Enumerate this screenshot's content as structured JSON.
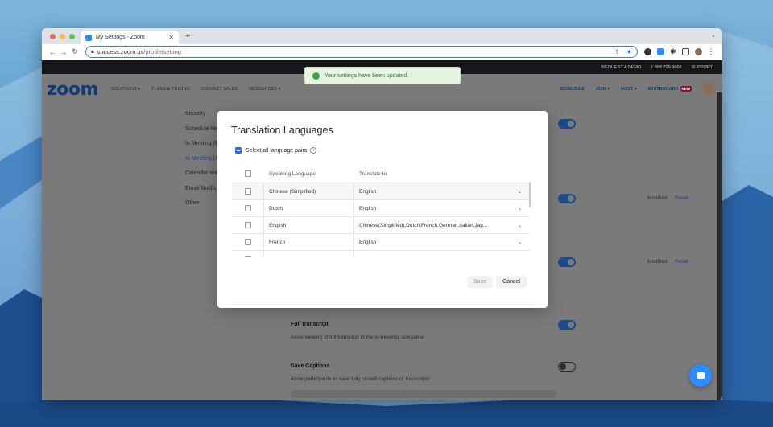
{
  "browser": {
    "tab_title": "My Settings - Zoom",
    "new_tab": "+",
    "url_host": "success.zoom.us",
    "url_path": "/profile/setting"
  },
  "zoom": {
    "topstrip": [
      "REQUEST A DEMO",
      "1.888.799.9666",
      "SUPPORT"
    ],
    "logo": "zoom",
    "nav_left": [
      "SOLUTIONS ▾",
      "PLANS & PRICING",
      "CONTACT SALES",
      "RESOURCES ▾"
    ],
    "nav_right": {
      "schedule": "SCHEDULE",
      "join": "JOIN ▾",
      "host": "HOST ▾",
      "whiteboard": "WHITEBOARD",
      "new_badge": "NEW"
    },
    "sidenav": [
      "Security",
      "Schedule Me",
      "In Meeting (B",
      "In Meeting (A",
      "Calendar and",
      "Email Notific",
      "Other"
    ],
    "modified_label": "Modified",
    "reset_label": "Reset",
    "settings": [
      {
        "title": "Full transcript",
        "desc": "Allow viewing of full transcript in the in-meeting side panel"
      },
      {
        "title": "Save Captions",
        "desc": "Allow participants to save fully closed captions or transcripts"
      }
    ]
  },
  "toast": {
    "text": "Your settings have been updated.",
    "color": "#3ca34a"
  },
  "modal": {
    "title": "Translation Languages",
    "select_all": "Select all language pairs",
    "col_speaking": "Speaking Language",
    "col_translate": "Translate to",
    "rows": [
      {
        "speaking": "Chinese (Simplified)",
        "translate": "English"
      },
      {
        "speaking": "Dutch",
        "translate": "English"
      },
      {
        "speaking": "English",
        "translate": "Chinese(Simplified),Dutch,French,German,Italian,Jap..."
      },
      {
        "speaking": "French",
        "translate": "English"
      }
    ],
    "save": "Save",
    "cancel": "Cancel"
  },
  "colors": {
    "accent": "#2d8cff",
    "toggle_on": "#1a4c8c",
    "link": "#123b7a"
  }
}
